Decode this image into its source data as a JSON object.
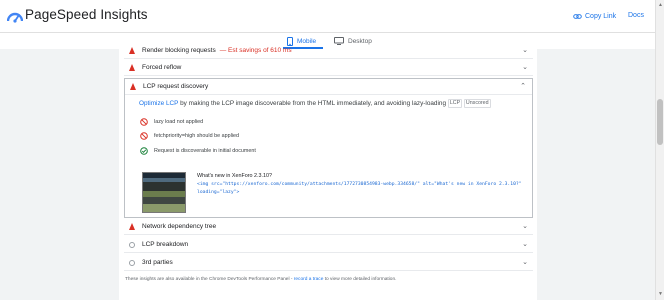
{
  "app": {
    "title": "PageSpeed Insights",
    "copy_link_label": "Copy Link",
    "docs_label": "Docs"
  },
  "device_tabs": [
    {
      "label": "Mobile",
      "selected": true
    },
    {
      "label": "Desktop",
      "selected": false
    }
  ],
  "insights": {
    "render_blocking": {
      "label": "Render blocking requests",
      "savings": "— Est savings of 610 ms",
      "status": "warning"
    },
    "forced_reflow": {
      "label": "Forced reflow",
      "status": "warning"
    },
    "lcp_discovery": {
      "label": "LCP request discovery",
      "status": "warning",
      "description_link": "Optimize LCP",
      "description_text": " by making the LCP image discoverable from the HTML immediately, and avoiding lazy-loading",
      "chips": [
        "LCP",
        "Unscored"
      ],
      "checks": [
        {
          "label": "lazy load not applied",
          "state": "fail"
        },
        {
          "label": "fetchpriority=high should be applied",
          "state": "fail"
        },
        {
          "label": "Request is discoverable in initial document",
          "state": "pass"
        }
      ],
      "node": {
        "title": "What's new in XenForo 2.3.10?",
        "code_line1": "<img src=\"https://xenforo.com/community/attachments/1772730854983-webp.334658/\" alt=\"What's new in XenForo 2.3.10?\"",
        "code_line2": "loading=\"lazy\">"
      }
    },
    "network_tree": {
      "label": "Network dependency tree",
      "status": "warning"
    },
    "lcp_breakdown": {
      "label": "LCP breakdown",
      "status": "info"
    },
    "third_parties": {
      "label": "3rd parties",
      "status": "info"
    }
  },
  "footer": {
    "text_before": "These insights are also available in the Chrome DevTools Performance Panel - ",
    "link": "record a trace",
    "text_after": " to view more detailed information."
  },
  "colors": {
    "accent": "#1a73e8",
    "fail": "#d93025",
    "pass": "#188038"
  }
}
